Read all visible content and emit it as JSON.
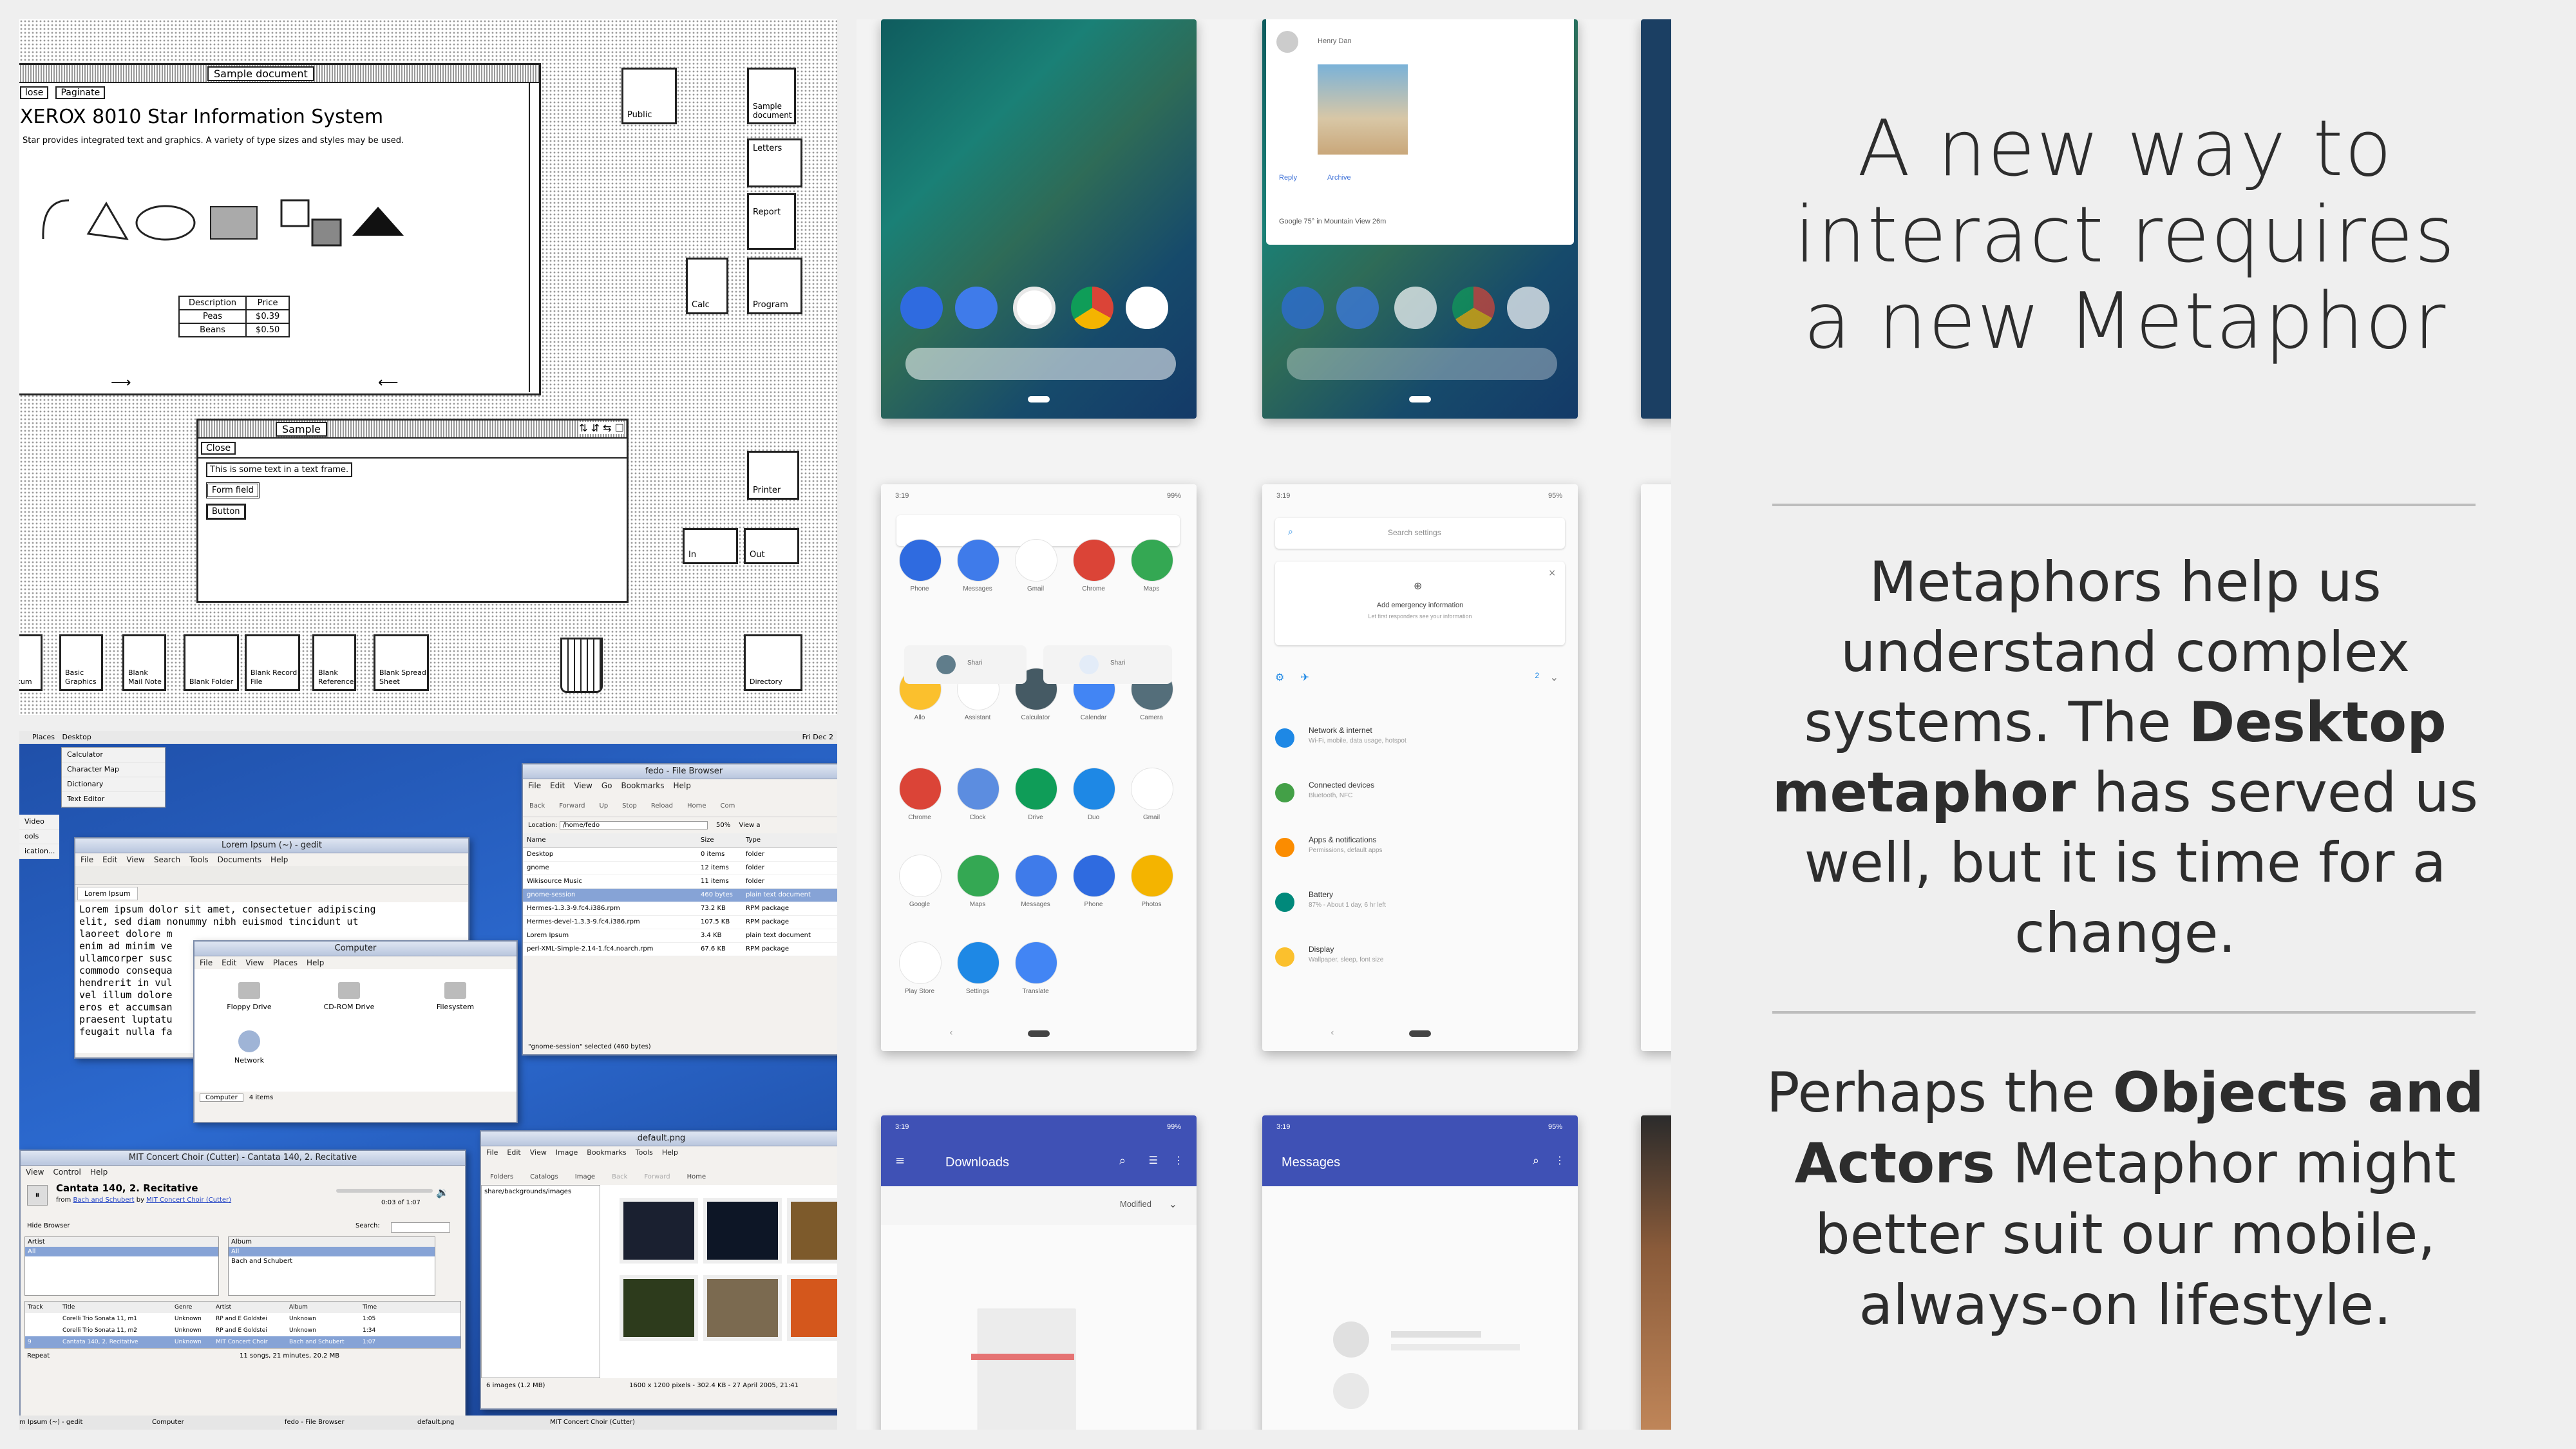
{
  "slide": {
    "title": "A new way to interact requires a new Metaphor",
    "paragraph1": {
      "part1": "Metaphors help us understand complex systems.  The ",
      "bold1": "Desktop metaphor",
      "part2": " has served us well, but it is time for a change."
    },
    "paragraph2": {
      "part1": "Perhaps the ",
      "bold1": "Objects and Actors",
      "part2": " Metaphor might better suit our mobile, always-on lifestyle."
    }
  },
  "xerox_star": {
    "doc_window_title": "Sample document",
    "doc_buttons": [
      "lose",
      "Paginate"
    ],
    "heading": "XEROX 8010 Star Information System",
    "body": "Star provides integrated text and graphics. A variety of type sizes and styles may be used.",
    "table": {
      "headers": [
        "Description",
        "Price"
      ],
      "rows": [
        [
          "Peas",
          "$0.39"
        ],
        [
          "Beans",
          "$0.50"
        ]
      ]
    },
    "form_window_title": "Sample",
    "form_close": "Close",
    "form_text": "This is some text in a text frame.",
    "form_field": "Form field",
    "form_button": "Button",
    "desktop_icons": {
      "public": "Public",
      "sample_doc": "Sample document",
      "letters": "Letters",
      "report": "Report",
      "calc": "Calc",
      "program": "Program",
      "printer": "Printer",
      "in": "In",
      "out": "Out",
      "bottom": [
        "nk cum",
        "Basic Graphics",
        "Blank Mail Note",
        "Blank Folder",
        "Blank Record File",
        "Blank Reference",
        "Blank Spread Sheet",
        "Directory"
      ]
    }
  },
  "linux_desktop": {
    "panel_menu": [
      "Places",
      "Desktop"
    ],
    "panel_clock": "Fri Dec 2",
    "accessories": [
      "Calculator",
      "Character Map",
      "Dictionary",
      "Text Editor"
    ],
    "left_items": [
      "Video",
      "ools",
      "ication..."
    ],
    "gedit": {
      "title": "Lorem Ipsum (~) - gedit",
      "menu": [
        "File",
        "Edit",
        "View",
        "Search",
        "Tools",
        "Documents",
        "Help"
      ],
      "tab": "Lorem Ipsum",
      "text": [
        "Lorem ipsum dolor sit amet, consectetuer adipiscing",
        "elit, sed diam nonummy nibh euismod tincidunt ut",
        "laoreet dolore m",
        "enim ad minim ve",
        "ullamcorper susc",
        "commodo consequa",
        "hendrerit in vul",
        "vel illum dolore",
        "eros et accumsan",
        "praesent luptatu",
        "feugait nulla fa"
      ]
    },
    "computer": {
      "title": "Computer",
      "menu": [
        "File",
        "Edit",
        "View",
        "Places",
        "Help"
      ],
      "items": [
        "Floppy Drive",
        "CD-ROM Drive",
        "Filesystem",
        "Network"
      ],
      "footer": "Computer",
      "count": "4 items"
    },
    "file_browser": {
      "title": "fedo - File Browser",
      "menu": [
        "File",
        "Edit",
        "View",
        "Go",
        "Bookmarks",
        "Help"
      ],
      "toolbar": [
        "Back",
        "Forward",
        "Up",
        "Stop",
        "Reload",
        "Home",
        "Com"
      ],
      "location_label": "Location:",
      "location": "/home/fedo",
      "zoom": "50%",
      "view_as": "View a",
      "columns": [
        "Name",
        "Size",
        "Type"
      ],
      "rows": [
        [
          "Desktop",
          "0 items",
          "folder"
        ],
        [
          "gnome",
          "12 items",
          "folder"
        ],
        [
          "Wikisource Music",
          "11 items",
          "folder"
        ],
        [
          "gnome-session",
          "460 bytes",
          "plain text document"
        ],
        [
          "Hermes-1.3.3-9.fc4.i386.rpm",
          "73.2 KB",
          "RPM package"
        ],
        [
          "Hermes-devel-1.3.3-9.fc4.i386.rpm",
          "107.5 KB",
          "RPM package"
        ],
        [
          "Lorem Ipsum",
          "3.4 KB",
          "plain text document"
        ],
        [
          "perl-XML-Simple-2.14-1.fc4.noarch.rpm",
          "67.6 KB",
          "RPM package"
        ]
      ],
      "status": "\"gnome-session\" selected (460 bytes)"
    },
    "music": {
      "title": "MIT Concert Choir (Cutter) - Cantata 140, 2. Recitative",
      "menu": [
        "View",
        "Control",
        "Help"
      ],
      "track": "Cantata 140, 2. Recitative",
      "from_prefix": "from",
      "album": "Bach and Schubert",
      "by": "by",
      "artist": "MIT Concert Choir (Cutter)",
      "time": "0:03 of 1:07",
      "hide_browser": "Hide Browser",
      "search": "Search:",
      "artist_col": [
        "Artist",
        "All"
      ],
      "album_col": [
        "Album",
        "All",
        "Bach and Schubert"
      ],
      "columns": [
        "Track",
        "Title",
        "Genre",
        "Artist",
        "Album",
        "Time"
      ],
      "rows": [
        [
          "",
          "Corelli Trio Sonata 11, m1",
          "Unknown",
          "RP and E Goldstei",
          "Unknown",
          "1:05"
        ],
        [
          "",
          "Corelli Trio Sonata 11, m2",
          "Unknown",
          "RP and E Goldstei",
          "Unknown",
          "1:34"
        ],
        [
          "9",
          "Cantata 140, 2. Recitative",
          "Unknown",
          "MIT Concert Choir",
          "Bach and Schubert",
          "1:07"
        ]
      ],
      "repeat": "Repeat",
      "summary": "11 songs, 21 minutes, 20.2 MB"
    },
    "image_viewer": {
      "title": "default.png",
      "menu": [
        "File",
        "Edit",
        "View",
        "Image",
        "Bookmarks",
        "Tools",
        "Help"
      ],
      "toolbar": [
        "Folders",
        "Catalogs",
        "Image",
        "Back",
        "Forward",
        "Home"
      ],
      "path": "share/backgrounds/images",
      "status": "6 images (1.2 MB)",
      "info": "1600 x 1200 pixels - 302.4 KB - 27 April 2005, 21:41"
    },
    "taskbar": [
      "m Ipsum (~) - gedit",
      "Computer",
      "fedo - File Browser",
      "default.png",
      "MIT Concert Choir (Cutter)"
    ]
  },
  "android": {
    "notification": {
      "sender": "Henry Dan",
      "actions": [
        "Reply",
        "Archive"
      ],
      "footer": "Google  75° in Mountain View  26m"
    },
    "status_time": "3:19",
    "battery": "99%",
    "battery2": "95%",
    "app_rows": [
      [
        "Phone",
        "Messages",
        "Gmail",
        "Chrome",
        "Maps"
      ],
      [
        "Allo",
        "Assistant",
        "Calculator",
        "Calendar",
        "Camera"
      ],
      [
        "Chrome",
        "Clock",
        "Drive",
        "Duo",
        "Gmail"
      ],
      [
        "Google",
        "Maps",
        "Messages",
        "Phone",
        "Photos"
      ],
      [
        "Play Store",
        "Settings",
        "Translate"
      ]
    ],
    "contacts": [
      "Shari",
      "Shari"
    ],
    "calendar_day": "31",
    "settings": {
      "search": "Search settings",
      "emergency_title": "Add emergency information",
      "emergency_sub": "Let first responders see your information",
      "count": "2",
      "rows": [
        {
          "title": "Network & internet",
          "sub": "Wi-Fi, mobile, data usage, hotspot",
          "color": "#1e88e5"
        },
        {
          "title": "Connected devices",
          "sub": "Bluetooth, NFC",
          "color": "#43a047"
        },
        {
          "title": "Apps & notifications",
          "sub": "Permissions, default apps",
          "color": "#fb8c00"
        },
        {
          "title": "Battery",
          "sub": "87% - About 1 day, 6 hr left",
          "color": "#00897b"
        },
        {
          "title": "Display",
          "sub": "Wallpaper, sleep, font size",
          "color": "#fbc02d"
        }
      ]
    },
    "downloads": {
      "title": "Downloads",
      "sort": "Modified"
    },
    "messages": {
      "title": "Messages"
    }
  },
  "colors": {
    "android_blue": "#3f51b5",
    "text": "#2d2d2d",
    "rule": "#bdbdbd"
  }
}
